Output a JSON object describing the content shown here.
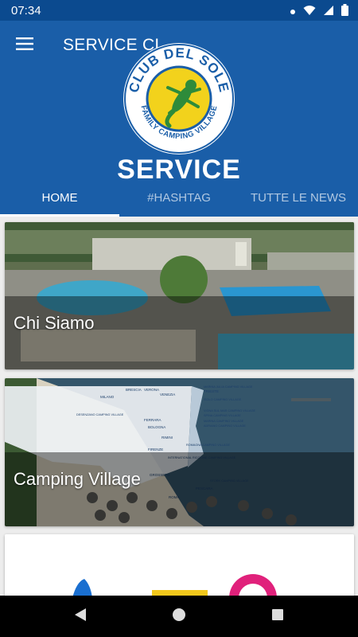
{
  "status_bar": {
    "time": "07:34",
    "icons": [
      "notification-dot-icon",
      "wifi-icon",
      "signal-icon",
      "battery-icon"
    ]
  },
  "app_bar": {
    "title": "SERVICE CL",
    "menu_icon": "hamburger-menu-icon",
    "hero_title": "SERVICE",
    "logo": {
      "top_text": "CLUB DEL SOLE",
      "bottom_text": "FAMILY CAMPING VILLAGE"
    }
  },
  "tabs": [
    {
      "label": "HOME",
      "active": true
    },
    {
      "label": "#HASHTAG",
      "active": false
    },
    {
      "label": "TUTTE LE NEWS",
      "active": false
    }
  ],
  "cards": [
    {
      "label": "Chi Siamo"
    },
    {
      "label": "Camping Village"
    }
  ],
  "map": {
    "cities": [
      "BRESCIA",
      "VERONA",
      "MILANO",
      "VENEZIA",
      "TRIESTE",
      "BOLOGNA",
      "FERRARA",
      "RIMINI",
      "FIRENZE",
      "GROSSETO",
      "ROMA",
      "PESCARA"
    ],
    "villages": [
      "MARINA JULIA CAMPING VILLAGE",
      "DESENZANO CAMPING VILLAGE",
      "ISOLO CAMPING VILLAGE",
      "VIGNA SUL MAR CAMPING VILLAGE",
      "SPINA CAMPING VILLAGE",
      "MARINA CAMPING VILLAGE",
      "ADRIANO CAMPING VILLAGE",
      "ROMAGNA CAMPING VILLAGE",
      "INTERNATIONAL RICCIONE CAMPING VILLAGE",
      "STORK CAMPING VILLAGE"
    ]
  },
  "colors": {
    "status_bar": "#0b4a8f",
    "app_bar": "#1a5ea8",
    "logo_yellow": "#f2d21c",
    "logo_green": "#2e8b3a",
    "background": "#ededed"
  },
  "nav_bar": {
    "icons": [
      "back-triangle-icon",
      "home-circle-icon",
      "recents-square-icon"
    ]
  }
}
